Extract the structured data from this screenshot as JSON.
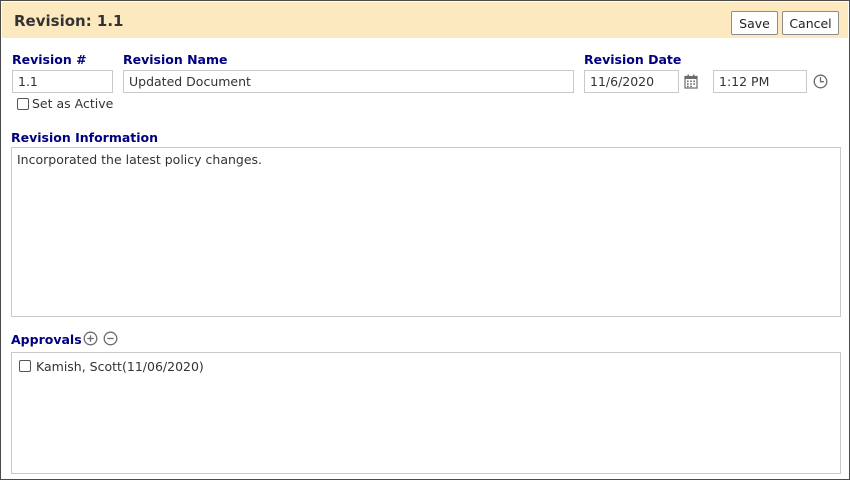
{
  "header": {
    "title": "Revision: 1.1",
    "save_label": "Save",
    "cancel_label": "Cancel"
  },
  "form": {
    "revision_number": {
      "label": "Revision #",
      "value": "1.1"
    },
    "set_active": {
      "label": "Set as Active",
      "checked": false
    },
    "revision_name": {
      "label": "Revision Name",
      "value": "Updated Document"
    },
    "revision_date": {
      "label": "Revision Date",
      "date_value": "11/6/2020",
      "time_value": "1:12 PM"
    },
    "revision_info": {
      "label": "Revision Information",
      "value": "Incorporated the latest policy changes."
    }
  },
  "approvals": {
    "label": "Approvals",
    "items": [
      {
        "name": "Kamish, Scott",
        "date": "(11/06/2020)",
        "checked": false
      }
    ]
  },
  "icons": {
    "calendar": "calendar-icon",
    "clock": "clock-icon",
    "add": "plus-circle-icon",
    "remove": "minus-circle-icon"
  },
  "colors": {
    "header_bg": "#fde9bf",
    "label_color": "#000080",
    "icon_color": "#6b6b6b"
  }
}
